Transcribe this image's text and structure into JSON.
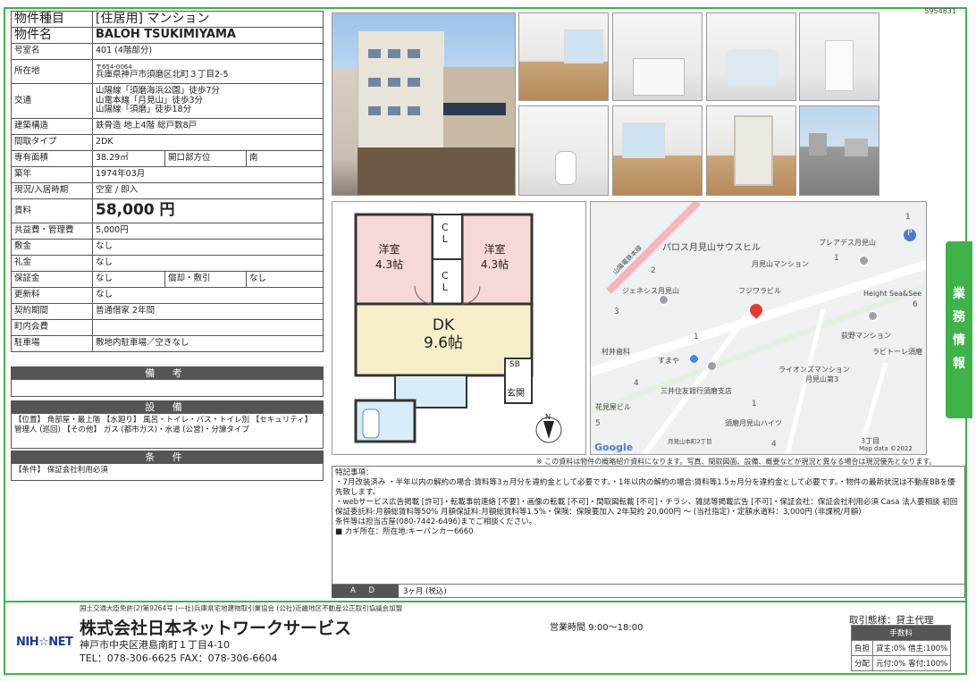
{
  "doc_id": "5954831",
  "property": {
    "type_label": "物件種目",
    "type_value": "[住居用] マンション",
    "name_label": "物件名",
    "name_value": "BALOH TSUKIMIYAMA",
    "room_label": "号室名",
    "room_value": "401 (4階部分)",
    "address_label": "所在地",
    "zip": "〒654-0064",
    "address_value": "兵庫県神戸市須磨区北町３丁目2-5",
    "traffic_label": "交通",
    "traffic_1": "山陽線「須磨海浜公園」徒歩7分",
    "traffic_2": "山電本線「月見山」徒歩3分",
    "traffic_3": "山陽線「須磨」徒歩18分",
    "structure_label": "建築構造",
    "structure_value": "鉄骨造 地上4階 総戸数8戸",
    "layout_label": "間取タイプ",
    "layout_value": "2DK",
    "area_label": "専有面積",
    "area_value": "38.29㎡",
    "direction_label": "開口部方位",
    "direction_value": "南",
    "built_label": "築年",
    "built_value": "1974年03月",
    "status_label": "現況/入居時期",
    "status_value": "空室 / 即入",
    "rent_label": "賃料",
    "rent_value": "58,000 円",
    "fee_label": "共益費・管理費",
    "fee_value": "5,000円",
    "deposit_label": "敷金",
    "deposit_value": "なし",
    "key_money_label": "礼金",
    "key_money_value": "なし",
    "guarantee_label": "保証金",
    "guarantee_value": "なし",
    "amort_label": "償却・敷引",
    "amort_value": "なし",
    "renewal_label": "更新料",
    "renewal_value": "なし",
    "contract_label": "契約期間",
    "contract_value": "普通借家 2年間",
    "town_fee_label": "町内会費",
    "town_fee_value": "",
    "parking_label": "駐車場",
    "parking_value": "敷地内駐車場／空きなし"
  },
  "sections": {
    "remarks_header": "備 考",
    "facilities_header": "設 備",
    "facilities_body": "【位置】 角部屋・最上階 【水廻り】 風呂・トイレ・バス・トイレ別 【セキュリティ】 管理人 (巡回) 【その他】 ガス (都市ガス)・水道 (公営)・分譲タイプ",
    "conditions_header": "条 件",
    "conditions_body": "【条件】 保証会社利用必須"
  },
  "floorplan": {
    "room1": "洋室",
    "room1_size": "4.3帖",
    "room2": "洋室",
    "room2_size": "4.3帖",
    "cl1": "C",
    "cl1b": "L",
    "cl2": "C",
    "cl2b": "L",
    "dk": "DK",
    "dk_size": "9.6帖",
    "sb": "SB",
    "entrance": "玄関",
    "north": "N"
  },
  "map": {
    "labels": [
      "パロス月見山サウスヒル",
      "プレアデス月見山",
      "月見山マンション",
      "ジェネシス月見山",
      "フジワラビル",
      "Height Sea&See",
      "荻野マンション",
      "ラビトーレ須磨",
      "村井歯科",
      "すまや",
      "ライオンズマンション",
      "月見山第3",
      "三井住友銀行須磨支店",
      "花見屋ビル",
      "須磨月見山ハイツ",
      "山陽電鉄本線",
      "月見山本町2丁目",
      "3丁目",
      "Google",
      "Map data ©2022"
    ],
    "nums": [
      "1",
      "2",
      "3",
      "1",
      "1",
      "6",
      "4",
      "1",
      "5",
      "4"
    ]
  },
  "disclaimer": "※ この資料は物件の概略紹介資料になります。写真、間取図面、設備、概要などが現況と異なる場合は現況優先となります。",
  "notes": {
    "title": "特記事項：",
    "line1": "・7月改装済み ・半年以内の解約の場合:賃料等3ヵ月分を違約金として必要です。・1年以内の解約の場合:賃料等1.5ヵ月分を違約金として必要です。・物件の最新状況は不動産BBを優先致します。",
    "line2": "・webサービス広告掲載 [許可]・転載事前連絡 [不要]・画像の転載 [不可]・間取図転載 [不可]・チラシ、雑誌等掲載広告 [不可]・保証会社：保証会社利用必須 Casa 法人要相談 初回保証委託料:月額総賃料等50% 月額保証料:月額総賃料等1.5%・保険：保険要加入 2年契約 20,000円 ～ (当社指定)・定額水道料：3,000円 (非課税/月額)",
    "line3": "条件等は担当古屋(080-7442-6496)までご相談ください。",
    "line4": "■ カギ所在：所在地:キーバンカー6660"
  },
  "ad": {
    "label": "A D",
    "value": "3ヶ月 (税込)"
  },
  "side_tab": [
    "業",
    "務",
    "情",
    "報"
  ],
  "footer": {
    "license": "国土交通大臣免許(2)第9264号 (一社)兵庫県宅地建物取引業協会 (公社)近畿地区不動産公正取引協議会加盟",
    "company": "株式会社日本ネットワークサービス",
    "address": "神戸市中央区港島南町１丁目4-10",
    "tel": "TEL：078-306-6625 FAX：078-306-6604",
    "logo": "NIH☆NET",
    "hours": "営業時間 9:00～18:00",
    "deal": "取引態様：貸主代理",
    "fee_header": "手数料",
    "burden_label": "負担",
    "burden_value": "貸主:0% 借主:100%",
    "split_label": "分配",
    "split_value": "元付:0% 客付:100%"
  }
}
